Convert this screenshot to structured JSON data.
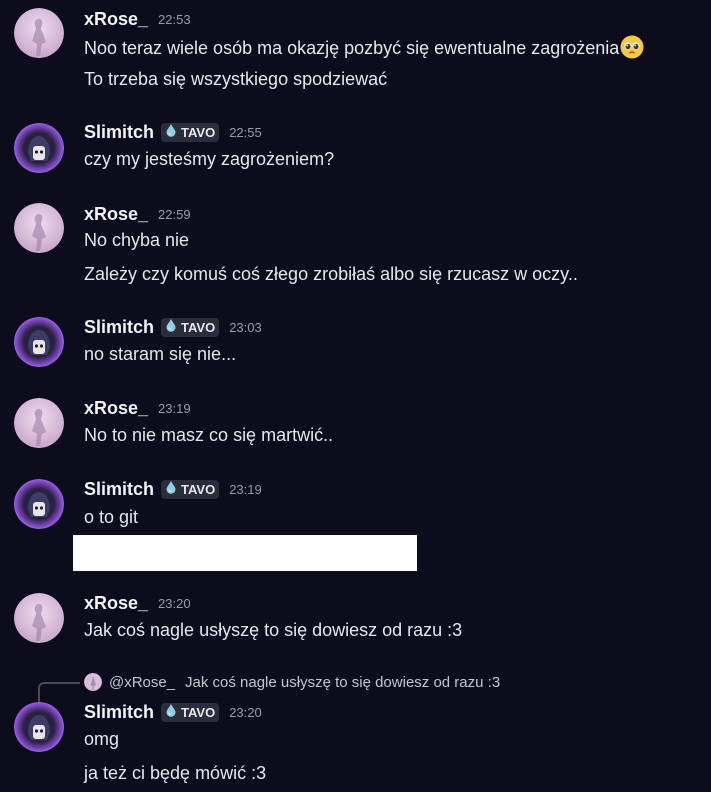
{
  "users": {
    "xrose": {
      "name": "xRose_"
    },
    "slimitch": {
      "name": "Slimitch",
      "tag": "TAVO"
    }
  },
  "messages": [
    {
      "user": "xRose_",
      "time": "22:53",
      "lines": [
        "Noo teraz wiele osób ma okazję pozbyć się ewentualne zagrożenia",
        "To trzeba się wszystkiego spodziewać"
      ],
      "emoji": "pleading-face"
    },
    {
      "user": "Slimitch",
      "tag": "TAVO",
      "time": "22:55",
      "lines": [
        "czy my jesteśmy zagrożeniem?"
      ]
    },
    {
      "user": "xRose_",
      "time": "22:59",
      "lines": [
        "No chyba nie",
        "Zależy czy komuś coś złego zrobiłaś albo się rzucasz w oczy.."
      ]
    },
    {
      "user": "Slimitch",
      "tag": "TAVO",
      "time": "23:03",
      "lines": [
        "no staram się nie..."
      ]
    },
    {
      "user": "xRose_",
      "time": "23:19",
      "lines": [
        "No to nie masz co się martwić.."
      ]
    },
    {
      "user": "Slimitch",
      "tag": "TAVO",
      "time": "23:19",
      "lines": [
        "o to git"
      ]
    },
    {
      "user": "xRose_",
      "time": "23:20",
      "lines": [
        "Jak coś nagle usłyszę to się dowiesz od razu :3"
      ]
    },
    {
      "user": "Slimitch",
      "tag": "TAVO",
      "time": "23:20",
      "lines": [
        "omg",
        "ja też ci będę mówić :3"
      ],
      "reply": {
        "user": "@xRose_",
        "text": "Jak coś nagle usłyszę to się dowiesz od razu :3"
      }
    }
  ],
  "colors": {
    "background": "#0c0c1c",
    "tag_bg": "#2b2d3a",
    "timestamp": "#9a9aa8",
    "redacted": "#ffffff"
  }
}
